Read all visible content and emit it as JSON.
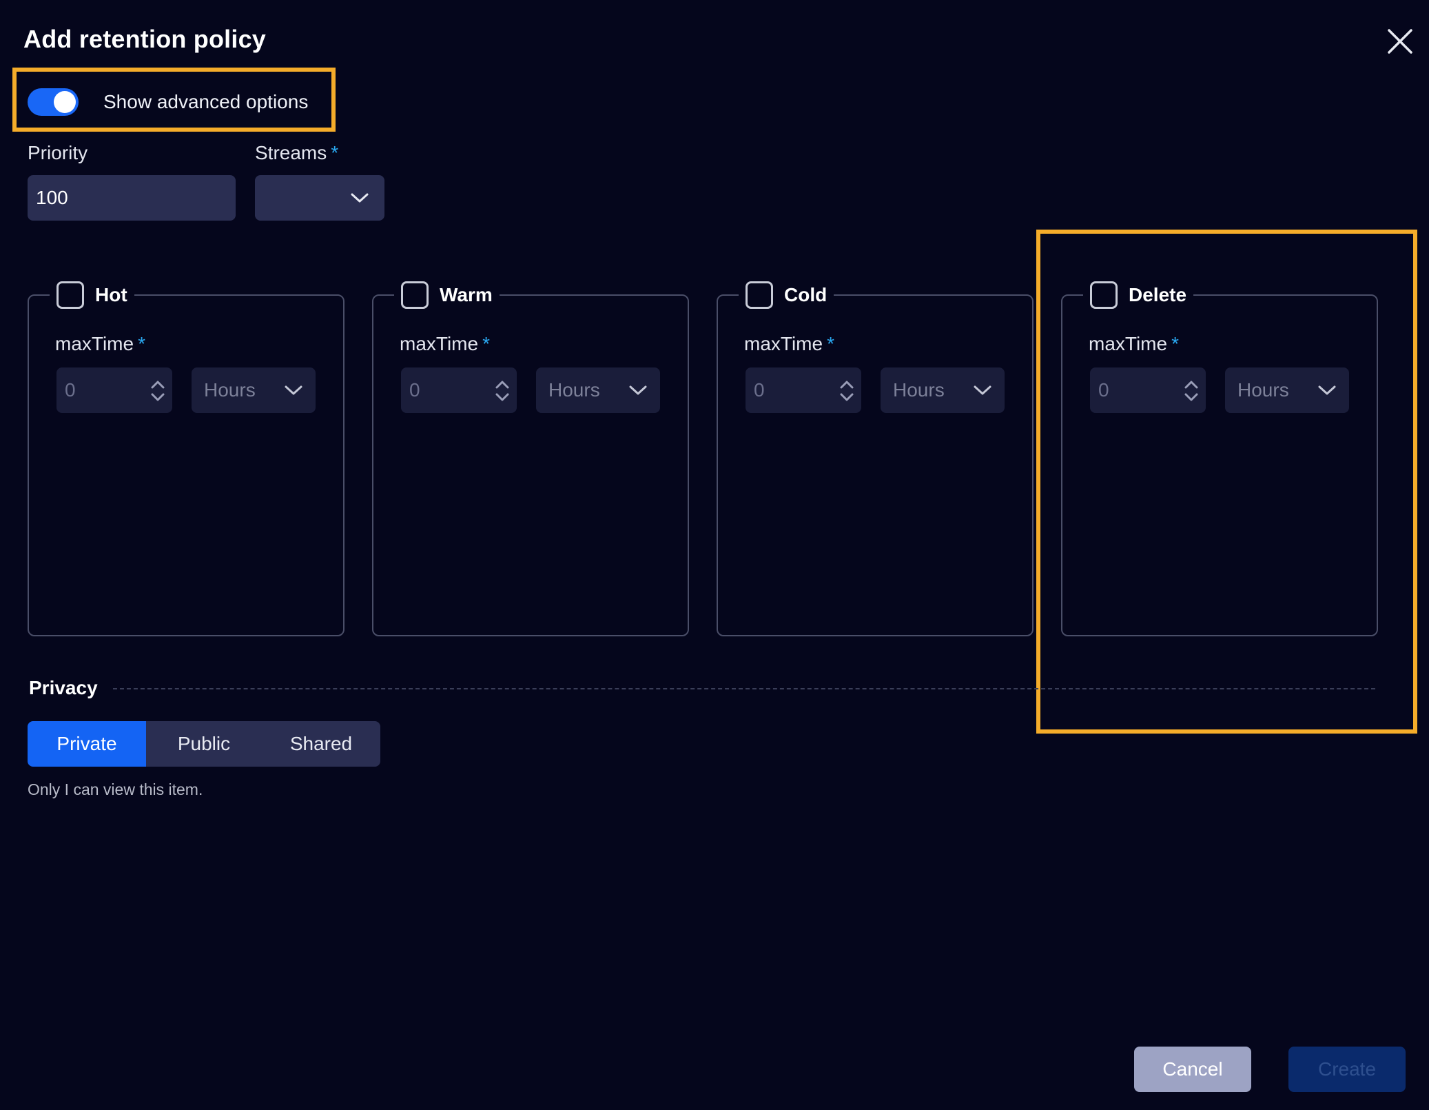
{
  "dialog": {
    "title": "Add retention policy"
  },
  "advanced_toggle": {
    "label": "Show advanced options",
    "checked": true
  },
  "priority": {
    "label": "Priority",
    "value": "100"
  },
  "streams": {
    "label": "Streams",
    "required_mark": "*",
    "value": ""
  },
  "tiers": [
    {
      "title": "Hot",
      "field_label": "maxTime",
      "required_mark": "*",
      "value": "0",
      "unit": "Hours",
      "checked": false
    },
    {
      "title": "Warm",
      "field_label": "maxTime",
      "required_mark": "*",
      "value": "0",
      "unit": "Hours",
      "checked": false
    },
    {
      "title": "Cold",
      "field_label": "maxTime",
      "required_mark": "*",
      "value": "0",
      "unit": "Hours",
      "checked": false
    },
    {
      "title": "Delete",
      "field_label": "maxTime",
      "required_mark": "*",
      "value": "0",
      "unit": "Hours",
      "checked": false
    }
  ],
  "privacy": {
    "title": "Privacy",
    "options": [
      "Private",
      "Public",
      "Shared"
    ],
    "selected": "Private",
    "help_text": "Only I can view this item."
  },
  "footer": {
    "cancel_label": "Cancel",
    "create_label": "Create"
  },
  "colors": {
    "background": "#05061c",
    "accent": "#1464f4",
    "highlight": "#f5ac2a",
    "required": "#2aa8f0"
  },
  "icons": [
    "close-icon",
    "chevron-down-icon",
    "spinner-updown-icon"
  ]
}
